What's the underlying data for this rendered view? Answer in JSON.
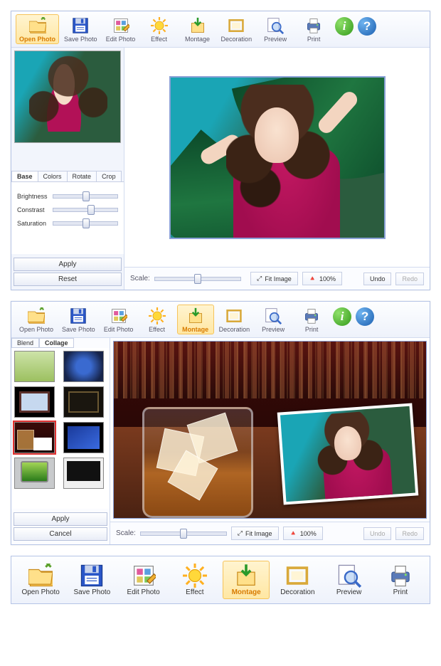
{
  "window1": {
    "toolbar": [
      {
        "label": "Open Photo",
        "icon": "folder",
        "selected": true
      },
      {
        "label": "Save Photo",
        "icon": "floppy"
      },
      {
        "label": "Edit Photo",
        "icon": "edit"
      },
      {
        "label": "Effect",
        "icon": "sun"
      },
      {
        "label": "Montage",
        "icon": "montage"
      },
      {
        "label": "Decoration",
        "icon": "frame"
      },
      {
        "label": "Preview",
        "icon": "magnify"
      },
      {
        "label": "Print",
        "icon": "printer"
      }
    ],
    "tabs": [
      "Base",
      "Colors",
      "Rotate",
      "Crop"
    ],
    "active_tab": "Base",
    "sliders": [
      {
        "label": "Brightness",
        "value": 0.5
      },
      {
        "label": "Constrast",
        "value": 0.58
      },
      {
        "label": "Saturation",
        "value": 0.5
      }
    ],
    "buttons": {
      "apply": "Apply",
      "reset": "Reset"
    },
    "status": {
      "scale_label": "Scale:",
      "fit": "Fit Image",
      "pct": "100%",
      "undo": "Undo",
      "redo": "Redo"
    }
  },
  "window2": {
    "toolbar": [
      {
        "label": "Open Photo",
        "icon": "folder"
      },
      {
        "label": "Save Photo",
        "icon": "floppy"
      },
      {
        "label": "Edit Photo",
        "icon": "edit"
      },
      {
        "label": "Effect",
        "icon": "sun"
      },
      {
        "label": "Montage",
        "icon": "montage",
        "selected": true
      },
      {
        "label": "Decoration",
        "icon": "frame"
      },
      {
        "label": "Preview",
        "icon": "magnify"
      },
      {
        "label": "Print",
        "icon": "printer"
      }
    ],
    "subtabs": [
      "Blend",
      "Collage"
    ],
    "active_subtab": "Collage",
    "buttons": {
      "apply": "Apply",
      "cancel": "Cancel"
    },
    "status": {
      "scale_label": "Scale:",
      "fit": "Fit Image",
      "pct": "100%",
      "undo": "Undo",
      "redo": "Redo"
    }
  },
  "window3": {
    "toolbar": [
      {
        "label": "Open Photo",
        "icon": "folder"
      },
      {
        "label": "Save Photo",
        "icon": "floppy"
      },
      {
        "label": "Edit Photo",
        "icon": "edit"
      },
      {
        "label": "Effect",
        "icon": "sun"
      },
      {
        "label": "Montage",
        "icon": "montage",
        "selected": true
      },
      {
        "label": "Decoration",
        "icon": "frame"
      },
      {
        "label": "Preview",
        "icon": "magnify"
      },
      {
        "label": "Print",
        "icon": "printer"
      }
    ]
  }
}
